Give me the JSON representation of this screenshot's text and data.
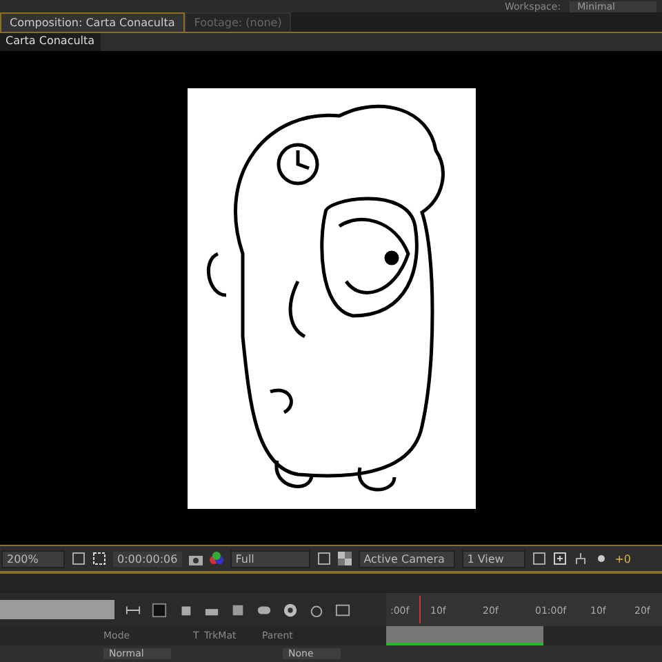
{
  "top_bar": {
    "workspace_label": "Workspace:",
    "workspace_value": "Minimal"
  },
  "tabs": [
    {
      "label": "Composition: Carta Conaculta",
      "selected": true
    },
    {
      "label": "Footage: (none)",
      "selected": false
    }
  ],
  "comp_tab": "Carta Conaculta",
  "viewer_toolbar": {
    "zoom": "200%",
    "timecode": "0:00:00:06",
    "resolution": "Full",
    "camera": "Active Camera",
    "views": "1 View",
    "exposure": "+0"
  },
  "timeline": {
    "ruler": [
      ":00f",
      "10f",
      "20f",
      "01:00f",
      "10f",
      "20f"
    ],
    "columns": [
      {
        "kind": "mode",
        "label": "Mode"
      },
      {
        "kind": "t",
        "label": "T"
      },
      {
        "kind": "trkmat",
        "label": "TrkMat"
      },
      {
        "kind": "parent",
        "label": "Parent"
      }
    ],
    "layer": {
      "mode": "Normal",
      "parent": "None"
    }
  }
}
